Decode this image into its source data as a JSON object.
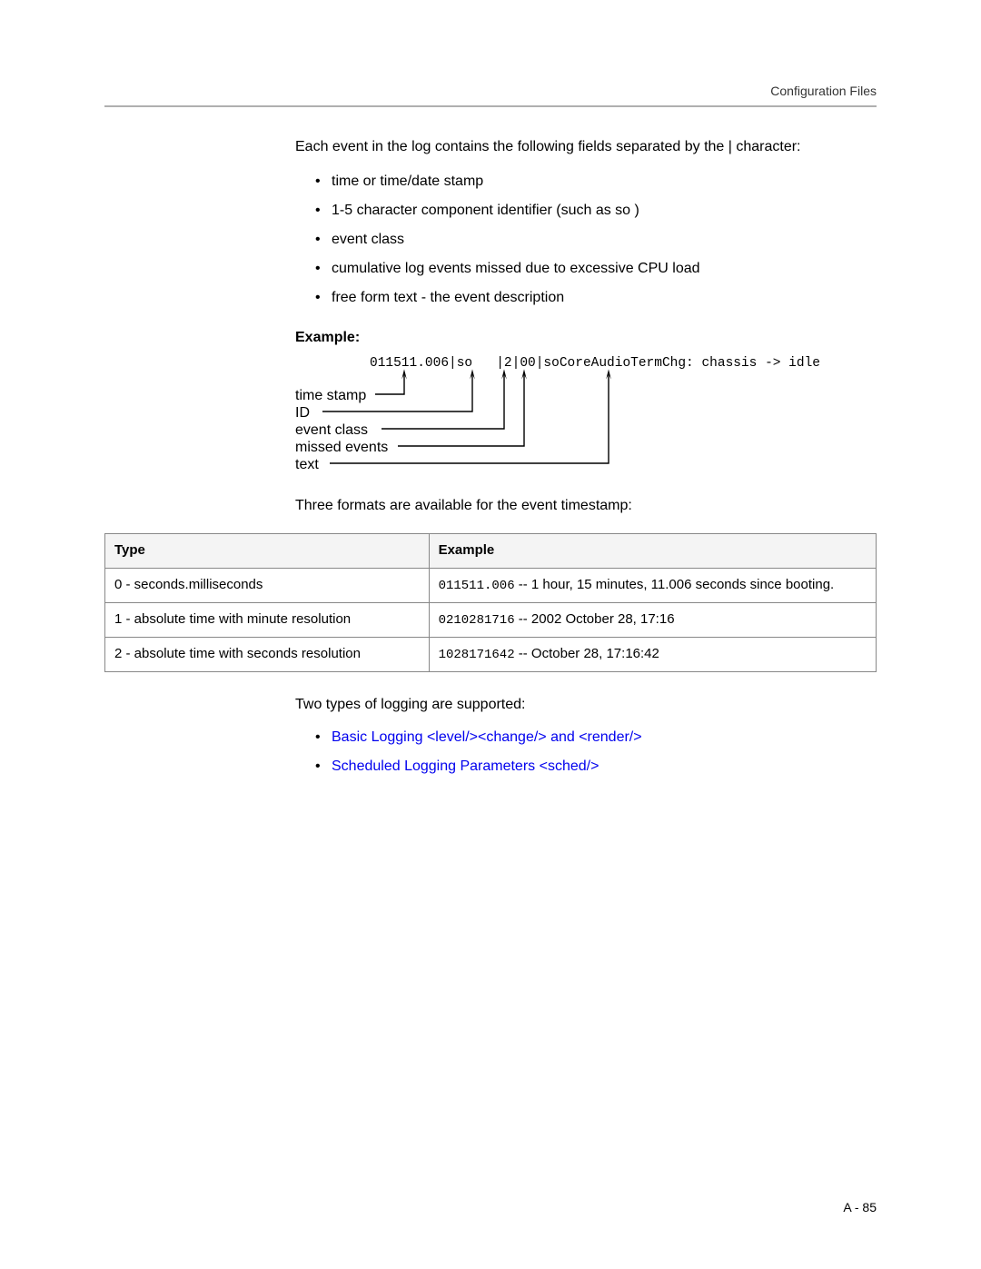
{
  "header": {
    "section": "Configuration Files"
  },
  "intro": "Each event in the log contains the following fields separated by the | character:",
  "bullets": {
    "b1": "time or time/date stamp",
    "b2": "1-5 character component identifier (such as  so )",
    "b3": "event class",
    "b4": "cumulative log events missed due to excessive CPU load",
    "b5": "free form text - the event description"
  },
  "example": {
    "heading": "Example:",
    "code": "011511.006|so   |2|00|soCoreAudioTermChg: chassis -> idle",
    "labels": {
      "l1": "time stamp",
      "l2": "ID",
      "l3": "event class",
      "l4": "missed events",
      "l5": "text"
    }
  },
  "after_diagram": "Three formats are available for the event timestamp:",
  "table": {
    "headers": {
      "c1": "Type",
      "c2": "Example"
    },
    "rows": [
      {
        "type": "0 - seconds.milliseconds",
        "code": "011511.006",
        "rest": " -- 1 hour, 15 minutes, 11.006 seconds since booting."
      },
      {
        "type": "1 - absolute time with minute resolution",
        "code": "0210281716",
        "rest": " -- 2002 October 28, 17:16"
      },
      {
        "type": "2 - absolute time with seconds resolution",
        "code": "1028171642",
        "rest": " -- October 28, 17:16:42"
      }
    ]
  },
  "two_types": "Two types of logging are supported:",
  "links": {
    "l1": "Basic Logging <level/><change/> and <render/>",
    "l2": "Scheduled Logging Parameters <sched/>"
  },
  "footer": {
    "page": "A - 85"
  }
}
